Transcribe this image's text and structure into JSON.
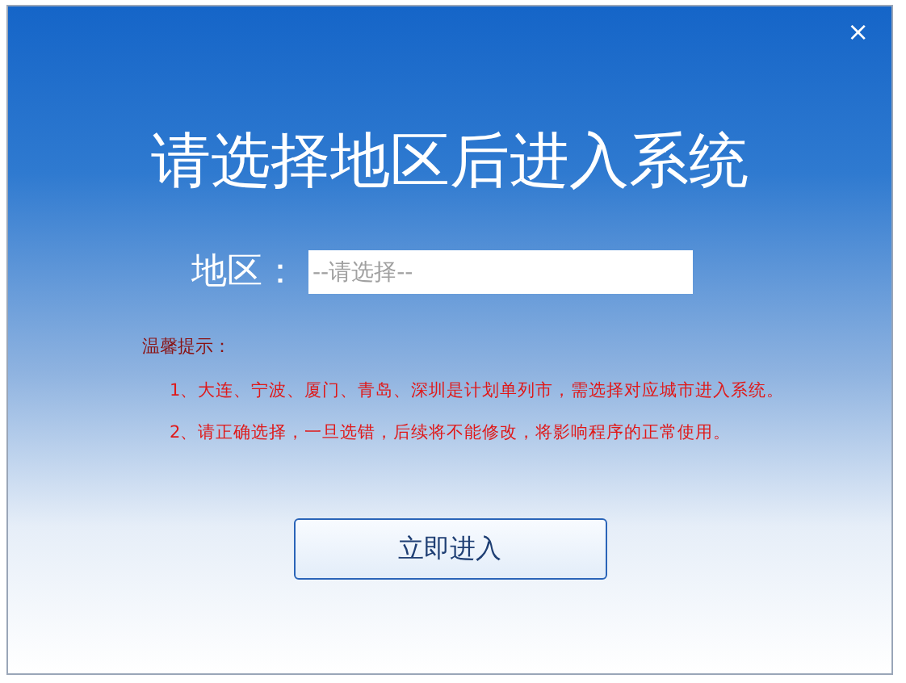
{
  "window": {
    "close": "×"
  },
  "title": "请选择地区后进入系统",
  "region": {
    "label": "地区：",
    "placeholder": "--请选择--"
  },
  "tips": {
    "heading": "温馨提示：",
    "items": [
      "1、大连、宁波、厦门、青岛、深圳是计划单列市，需选择对应城市进入系统。",
      "2、请正确选择，一旦选错，后续将不能修改，将影响程序的正常使用。"
    ]
  },
  "button": "立即进入"
}
